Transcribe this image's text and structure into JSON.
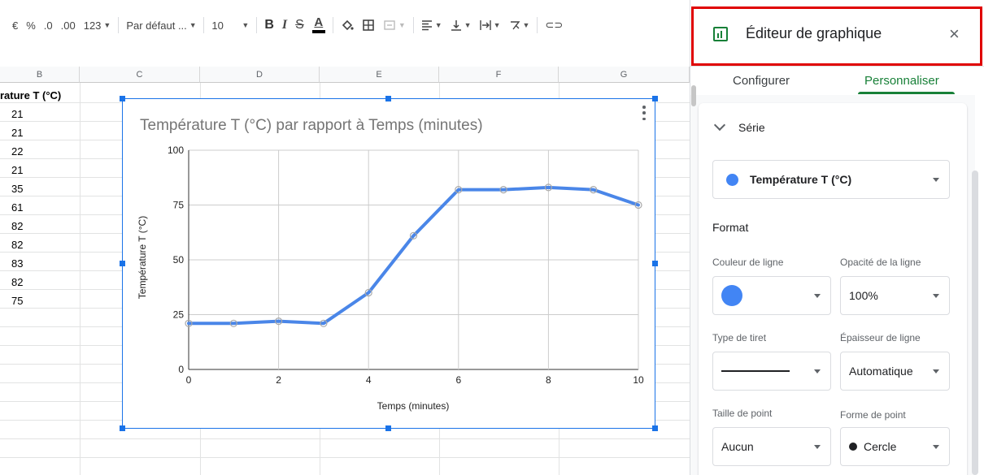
{
  "toolbar": {
    "currency": "€",
    "percent": "%",
    "dec_less": ".0",
    "dec_more": ".00",
    "format_more": "123",
    "font": "Par défaut ...",
    "font_size": "10",
    "bold": "B",
    "italic": "I",
    "strike": "S",
    "text_color": "A",
    "link": "⊂⊃"
  },
  "grid": {
    "columns": [
      "B",
      "C",
      "D",
      "E",
      "F",
      "G"
    ],
    "col_b_header": "rature T (°C)",
    "col_b_values": [
      "21",
      "21",
      "22",
      "21",
      "35",
      "61",
      "82",
      "82",
      "83",
      "82",
      "75"
    ]
  },
  "chart_data": {
    "type": "line",
    "title": "Température T (°C) par rapport à Temps (minutes)",
    "xlabel": "Temps (minutes)",
    "ylabel": "Température T (°C)",
    "x": [
      0,
      1,
      2,
      3,
      4,
      5,
      6,
      7,
      8,
      9,
      10
    ],
    "series": [
      {
        "name": "Température T (°C)",
        "values": [
          21,
          21,
          22,
          21,
          35,
          61,
          82,
          82,
          83,
          82,
          75
        ],
        "color": "#4a86e8"
      }
    ],
    "xlim": [
      0,
      10
    ],
    "ylim": [
      0,
      100
    ],
    "x_ticks": [
      "0",
      "2",
      "4",
      "6",
      "8",
      "10"
    ],
    "y_ticks": [
      "0",
      "25",
      "50",
      "75",
      "100"
    ],
    "grid": true,
    "legend": "none"
  },
  "panel": {
    "title": "Éditeur de graphique",
    "close": "×",
    "tabs": [
      "Configurer",
      "Personnaliser"
    ],
    "active_tab": "Personnaliser",
    "section": "Série",
    "series_select": "Température T (°C)",
    "format_heading": "Format",
    "line_color_label": "Couleur de ligne",
    "line_opacity_label": "Opacité de la ligne",
    "line_opacity_value": "100%",
    "dash_type_label": "Type de tiret",
    "line_width_label": "Épaisseur de ligne",
    "line_width_value": "Automatique",
    "point_size_label": "Taille de point",
    "point_size_value": "Aucun",
    "point_shape_label": "Forme de point",
    "point_shape_value": "Cercle",
    "accent_color": "#188038",
    "highlight_color": "#e00000"
  }
}
